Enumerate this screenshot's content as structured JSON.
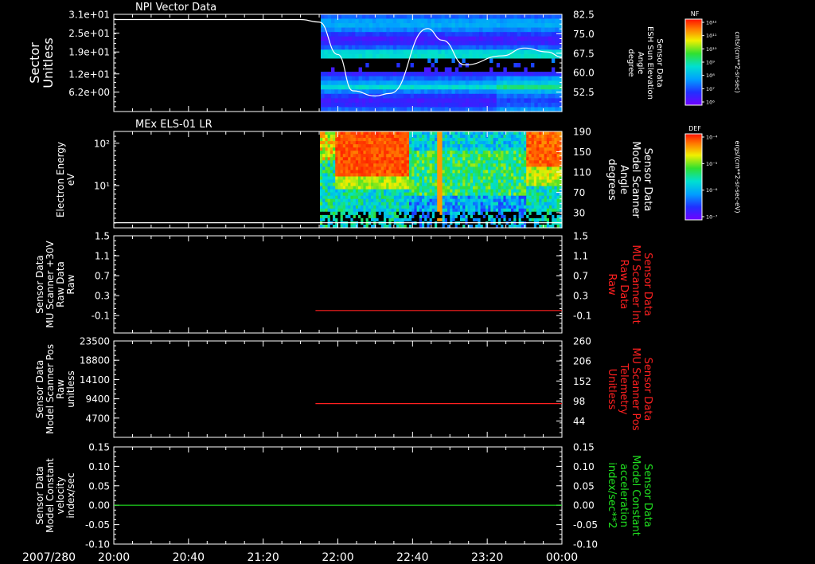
{
  "footer": {
    "date_label": "2007/280",
    "time_ticks": [
      "20:00",
      "20:40",
      "21:20",
      "22:00",
      "22:40",
      "23:20",
      "00:00"
    ]
  },
  "colors": {
    "white": "#ffffff",
    "red": "#ff2020",
    "green": "#20e020"
  },
  "chart_data": [
    {
      "type": "heatmap",
      "title": "NPI Vector Data",
      "left_axis": {
        "label_lines": [
          "Sector",
          "Unitless"
        ],
        "ticks": [
          {
            "label": "3.1e+01",
            "value": 31.0
          },
          {
            "label": "2.5e+01",
            "value": 25.0
          },
          {
            "label": "1.9e+01",
            "value": 19.0
          },
          {
            "label": "1.2e+01",
            "value": 12.0
          },
          {
            "label": "6.2e+00",
            "value": 6.2
          }
        ],
        "ylim": [
          0,
          31
        ]
      },
      "right_axis": {
        "label_lines": [
          "Sensor Data",
          "ESH Sun Elevation",
          "Angle",
          "degree"
        ],
        "ticks": [
          "82.5",
          "75.0",
          "67.5",
          "60.0",
          "52.5"
        ],
        "tick_values": [
          82.5,
          75.0,
          67.5,
          60.0,
          52.5
        ],
        "ylim": [
          45,
          82.5
        ]
      },
      "data_start_time": "21:50",
      "overlay_line": {
        "axis": "right",
        "color": "white",
        "x": [
          "20:00",
          "21:40",
          "21:50",
          "22:00",
          "22:08",
          "22:20",
          "22:28",
          "22:48",
          "22:56",
          "23:08",
          "23:28",
          "23:40",
          "23:52",
          "00:00"
        ],
        "y": [
          80.5,
          80.5,
          79.5,
          67,
          53,
          51,
          52,
          77,
          72.5,
          63,
          66.5,
          69.5,
          68,
          66
        ]
      },
      "colorbar": {
        "label": "NF",
        "unit": "cnts/(cm**2-sr-sec)",
        "tick_labels": [
          "10¹²",
          "10¹¹",
          "10¹⁰",
          "10⁹",
          "10⁸",
          "10⁷",
          "10⁶"
        ]
      }
    },
    {
      "type": "heatmap",
      "title": "MEx ELS-01 LR",
      "left_axis": {
        "label_lines": [
          "Electron Energy",
          "eV"
        ],
        "ticks": [
          {
            "label": "10²",
            "value": 100
          },
          {
            "label": "10¹",
            "value": 10
          }
        ],
        "scale": "log",
        "ylim": [
          1,
          190
        ]
      },
      "right_axis": {
        "label_lines": [
          "Sensor Data",
          "Model Scanner",
          "Angle",
          "degrees"
        ],
        "ticks": [
          "190",
          "150",
          "110",
          "70",
          "30"
        ],
        "tick_values": [
          190,
          150,
          110,
          70,
          30
        ],
        "ylim": [
          0,
          190
        ]
      },
      "data_start_time": "21:50",
      "overlay_line": {
        "axis": "right",
        "color": "white",
        "x": [
          "20:00",
          "00:00"
        ],
        "y": [
          10,
          10
        ]
      },
      "colorbar": {
        "label": "DEF",
        "unit": "ergs/(cm**2-sr-sec-eV)",
        "tick_labels": [
          "10⁻⁴",
          "10⁻⁵",
          "10⁻⁶",
          "10⁻⁷"
        ]
      }
    },
    {
      "type": "line",
      "left_axis": {
        "label_lines": [
          "Sensor Data",
          "MU Scanner +30V",
          "Raw Data",
          "Raw"
        ],
        "ticks": [
          "1.5",
          "1.1",
          "0.7",
          "0.3",
          "-0.1"
        ],
        "tick_values": [
          1.5,
          1.1,
          0.7,
          0.3,
          -0.1
        ],
        "ylim": [
          -0.45,
          1.5
        ]
      },
      "right_axis": {
        "label_lines": [
          "Sensor Data",
          "MU Scanner Int",
          "Raw Data",
          "Raw"
        ],
        "ticks": [
          "1.5",
          "1.1",
          "0.7",
          "0.3",
          "-0.1"
        ],
        "tick_values": [
          1.5,
          1.1,
          0.7,
          0.3,
          -0.1
        ],
        "ylim": [
          -0.45,
          1.5
        ],
        "color": "red"
      },
      "series": [
        {
          "axis": "right",
          "color": "red",
          "x": [
            "21:48",
            "00:00"
          ],
          "y": [
            0.0,
            0.0
          ]
        }
      ]
    },
    {
      "type": "line",
      "left_axis": {
        "label_lines": [
          "Sensor Data",
          "Model Scanner Pos",
          "Raw",
          "unitless"
        ],
        "ticks": [
          "23500",
          "18800",
          "14100",
          "9400",
          "4700"
        ],
        "tick_values": [
          23500,
          18800,
          14100,
          9400,
          4700
        ],
        "ylim": [
          0,
          23500
        ]
      },
      "right_axis": {
        "label_lines": [
          "Sensor Data",
          "MU Scanner Pos",
          "Telemetry",
          "Unitless"
        ],
        "ticks": [
          "260",
          "206",
          "152",
          "98",
          "44"
        ],
        "tick_values": [
          260,
          206,
          152,
          98,
          44
        ],
        "ylim": [
          0,
          260
        ],
        "color": "red"
      },
      "series": [
        {
          "axis": "right",
          "color": "red",
          "x": [
            "21:48",
            "00:00"
          ],
          "y": [
            91,
            91
          ]
        }
      ]
    },
    {
      "type": "line",
      "left_axis": {
        "label_lines": [
          "Sensor Data",
          "Model Constant",
          "velocity",
          "index/sec"
        ],
        "ticks": [
          "0.15",
          "0.10",
          "0.05",
          "0.00",
          "-0.05",
          "-0.10"
        ],
        "tick_values": [
          0.15,
          0.1,
          0.05,
          0.0,
          -0.05,
          -0.1
        ],
        "ylim": [
          -0.1,
          0.15
        ]
      },
      "right_axis": {
        "label_lines": [
          "Sensor Data",
          "Model Constant",
          "acceleration",
          "index/sec**2"
        ],
        "ticks": [
          "0.15",
          "0.10",
          "0.05",
          "0.00",
          "-0.05",
          "-0.10"
        ],
        "tick_values": [
          0.15,
          0.1,
          0.05,
          0.0,
          -0.05,
          -0.1
        ],
        "ylim": [
          -0.1,
          0.15
        ],
        "color": "green"
      },
      "series": [
        {
          "axis": "left",
          "color": "green",
          "x": [
            "20:00",
            "00:00"
          ],
          "y": [
            0.0,
            0.0
          ]
        }
      ]
    }
  ]
}
